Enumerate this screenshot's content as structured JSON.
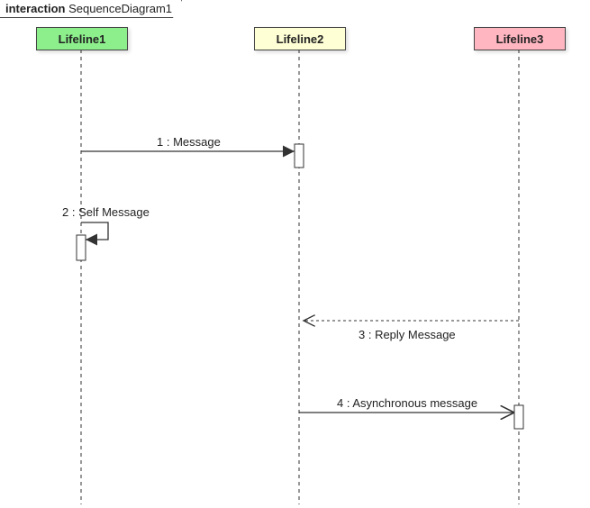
{
  "frame": {
    "keyword": "interaction",
    "name": "SequenceDiagram1"
  },
  "lifelines": [
    {
      "label": "Lifeline1",
      "color": "#8cef8c"
    },
    {
      "label": "Lifeline2",
      "color": "#feffd5"
    },
    {
      "label": "Lifeline3",
      "color": "#ffb6c1"
    }
  ],
  "messages": [
    {
      "index": 1,
      "label": "1 : Message",
      "from": "Lifeline1",
      "to": "Lifeline2",
      "type": "sync"
    },
    {
      "index": 2,
      "label": "2 : Self Message",
      "from": "Lifeline1",
      "to": "Lifeline1",
      "type": "self"
    },
    {
      "index": 3,
      "label": "3 : Reply Message",
      "from": "Lifeline3",
      "to": "Lifeline2",
      "type": "reply"
    },
    {
      "index": 4,
      "label": "4 : Asynchronous message",
      "from": "Lifeline2",
      "to": "Lifeline3",
      "type": "async"
    }
  ],
  "chart_data": {
    "type": "sequence-diagram",
    "title": "SequenceDiagram1",
    "participants": [
      "Lifeline1",
      "Lifeline2",
      "Lifeline3"
    ],
    "events": [
      {
        "from": "Lifeline1",
        "to": "Lifeline2",
        "label": "Message",
        "kind": "sync"
      },
      {
        "from": "Lifeline1",
        "to": "Lifeline1",
        "label": "Self Message",
        "kind": "self"
      },
      {
        "from": "Lifeline3",
        "to": "Lifeline2",
        "label": "Reply Message",
        "kind": "reply"
      },
      {
        "from": "Lifeline2",
        "to": "Lifeline3",
        "label": "Asynchronous message",
        "kind": "async"
      }
    ]
  }
}
